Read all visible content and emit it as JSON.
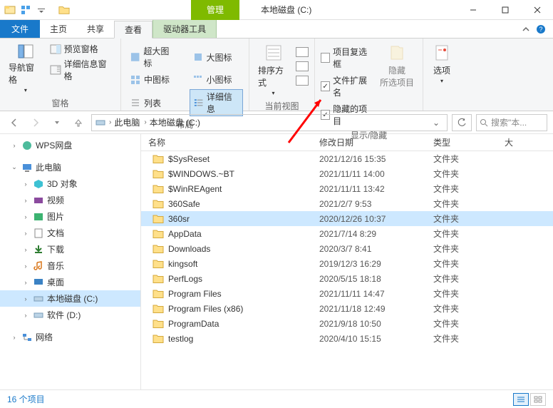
{
  "title": {
    "manage": "管理",
    "drive_title": "本地磁盘 (C:)"
  },
  "menubar": {
    "file": "文件",
    "home": "主页",
    "share": "共享",
    "view": "查看",
    "drive_tools": "驱动器工具"
  },
  "ribbon": {
    "group_pane": {
      "nav_panes": "导航窗格",
      "preview": "预览窗格",
      "details_pane": "详细信息窗格",
      "label": "窗格"
    },
    "group_layout": {
      "xl": "超大图标",
      "l": "大图标",
      "m": "中图标",
      "s": "小图标",
      "list": "列表",
      "details": "详细信息",
      "label": "布局"
    },
    "group_view": {
      "sort": "排序方式",
      "label": "当前视图"
    },
    "group_show": {
      "item_chk": "项目复选框",
      "file_ext": "文件扩展名",
      "hidden": "隐藏的项目",
      "hide_sel": "隐藏\n所选项目",
      "label": "显示/隐藏"
    },
    "group_opt": {
      "options": "选项"
    }
  },
  "breadcrumb": {
    "pc": "此电脑",
    "drive": "本地磁盘 (C:)"
  },
  "search_placeholder": "搜索\"本...",
  "columns": {
    "name": "名称",
    "date": "修改日期",
    "type": "类型",
    "size": "大"
  },
  "sidebar": {
    "wps": "WPS网盘",
    "pc": "此电脑",
    "threed": "3D 对象",
    "video": "视频",
    "pics": "图片",
    "docs": "文档",
    "downloads": "下载",
    "music": "音乐",
    "desktop": "桌面",
    "cdrive": "本地磁盘 (C:)",
    "ddrive": "软件 (D:)",
    "network": "网络"
  },
  "files": [
    {
      "name": "$SysReset",
      "date": "2021/12/16 15:35",
      "type": "文件夹"
    },
    {
      "name": "$WINDOWS.~BT",
      "date": "2021/11/11 14:00",
      "type": "文件夹"
    },
    {
      "name": "$WinREAgent",
      "date": "2021/11/11 13:42",
      "type": "文件夹"
    },
    {
      "name": "360Safe",
      "date": "2021/2/7 9:53",
      "type": "文件夹"
    },
    {
      "name": "360sr",
      "date": "2020/12/26 10:37",
      "type": "文件夹",
      "selected": true
    },
    {
      "name": "AppData",
      "date": "2021/7/14 8:29",
      "type": "文件夹"
    },
    {
      "name": "Downloads",
      "date": "2020/3/7 8:41",
      "type": "文件夹"
    },
    {
      "name": "kingsoft",
      "date": "2019/12/3 16:29",
      "type": "文件夹"
    },
    {
      "name": "PerfLogs",
      "date": "2020/5/15 18:18",
      "type": "文件夹"
    },
    {
      "name": "Program Files",
      "date": "2021/11/11 14:47",
      "type": "文件夹"
    },
    {
      "name": "Program Files (x86)",
      "date": "2021/11/18 12:49",
      "type": "文件夹"
    },
    {
      "name": "ProgramData",
      "date": "2021/9/18 10:50",
      "type": "文件夹"
    },
    {
      "name": "testlog",
      "date": "2020/4/10 15:15",
      "type": "文件夹"
    }
  ],
  "status": "16 个项目"
}
